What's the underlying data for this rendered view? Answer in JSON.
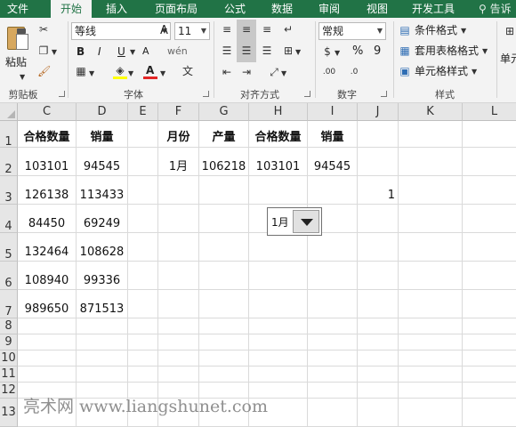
{
  "ribbon_tabs": [
    {
      "label": "文件"
    },
    {
      "label": "开始"
    },
    {
      "label": "插入"
    },
    {
      "label": "页面布局"
    },
    {
      "label": "公式"
    },
    {
      "label": "数据"
    },
    {
      "label": "审阅"
    },
    {
      "label": "视图"
    },
    {
      "label": "开发工具"
    }
  ],
  "tell_me": "告诉",
  "clipboard": {
    "paste_label": "粘贴",
    "group_label": "剪贴板"
  },
  "font": {
    "name": "等线",
    "size": "11",
    "bold": "B",
    "italic": "I",
    "underline": "U",
    "grow": "A",
    "shrink": "A",
    "fill_color_letter": "",
    "font_color_letter": "A",
    "phonetic": "wén",
    "group_label": "字体"
  },
  "alignment": {
    "group_label": "对齐方式"
  },
  "number": {
    "format": "常规",
    "percent": "%",
    "comma": "9",
    "group_label": "数字"
  },
  "styles": {
    "conditional": "条件格式",
    "table": "套用表格格式",
    "cell": "单元格样式",
    "group_label": "样式"
  },
  "cells_group": {
    "label": "单元"
  },
  "columns": [
    "C",
    "D",
    "E",
    "F",
    "G",
    "H",
    "I",
    "J",
    "K",
    "L"
  ],
  "rows": [
    "1",
    "2",
    "3",
    "4",
    "5",
    "6",
    "7",
    "8",
    "9",
    "10",
    "11",
    "12",
    "13"
  ],
  "grid": {
    "C1": "合格数量",
    "D1": "销量",
    "F1": "月份",
    "G1": "产量",
    "H1": "合格数量",
    "I1": "销量",
    "C2": "103101",
    "D2": "94545",
    "F2": "1月",
    "G2": "106218",
    "H2": "103101",
    "I2": "94545",
    "C3": "126138",
    "D3": "113433",
    "J3": "1",
    "C4": "84450",
    "D4": "69249",
    "C5": "132464",
    "D5": "108628",
    "C6": "108940",
    "D6": "99336",
    "C7": "989650",
    "D7": "871513"
  },
  "combo_box": {
    "value": "1月"
  },
  "watermark": "亮术网 www.liangshunet.com"
}
